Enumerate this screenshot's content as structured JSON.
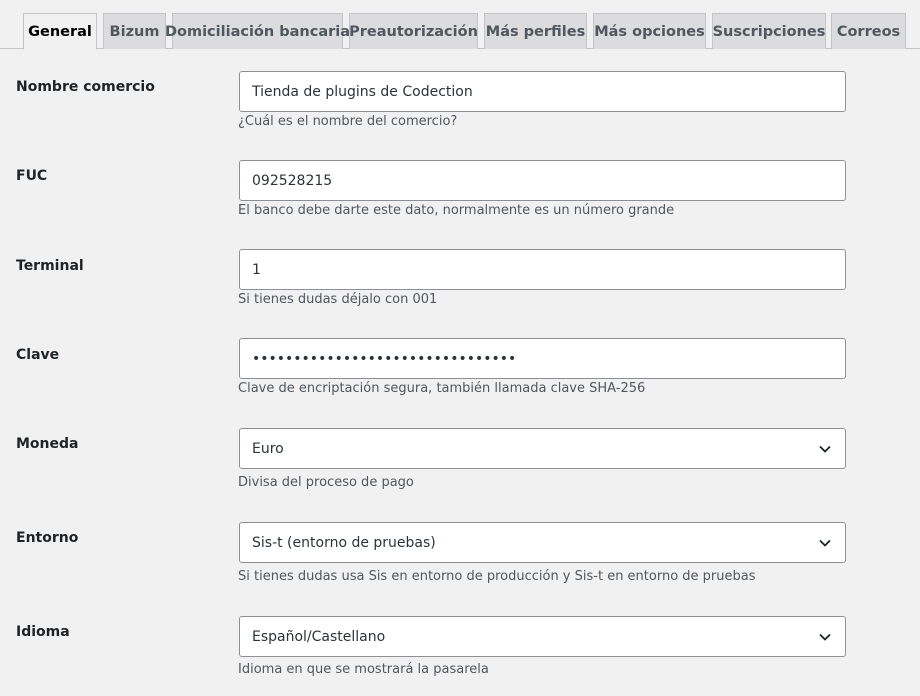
{
  "tabs": [
    {
      "label": "General",
      "active": true
    },
    {
      "label": "Bizum",
      "active": false
    },
    {
      "label": "Domiciliación bancaria",
      "active": false
    },
    {
      "label": "Preautorización",
      "active": false
    },
    {
      "label": "Más perfiles",
      "active": false
    },
    {
      "label": "Más opciones",
      "active": false
    },
    {
      "label": "Suscripciones",
      "active": false
    },
    {
      "label": "Correos",
      "active": false
    }
  ],
  "fields": {
    "nombre": {
      "label": "Nombre comercio",
      "value": "Tienda de plugins de Codection",
      "description": "¿Cuál es el nombre del comercio?"
    },
    "fuc": {
      "label": "FUC",
      "value": "092528215",
      "description": "El banco debe darte este dato, normalmente es un número grande"
    },
    "terminal": {
      "label": "Terminal",
      "value": "1",
      "description": "Si tienes dudas déjalo con 001"
    },
    "clave": {
      "label": "Clave",
      "value": "••••••••••••••••••••••••••••••••",
      "description": "Clave de encriptación segura, también llamada clave SHA-256"
    },
    "moneda": {
      "label": "Moneda",
      "selected": "Euro",
      "description": "Divisa del proceso de pago"
    },
    "entorno": {
      "label": "Entorno",
      "selected": "Sis-t (entorno de pruebas)",
      "description": "Si tienes dudas usa Sis en entorno de producción y Sis-t en entorno de pruebas"
    },
    "idioma": {
      "label": "Idioma",
      "selected": "Español/Castellano",
      "description": "Idioma en que se mostrará la pasarela"
    }
  },
  "icons": {
    "select_arrow": "chevron-down-icon"
  }
}
